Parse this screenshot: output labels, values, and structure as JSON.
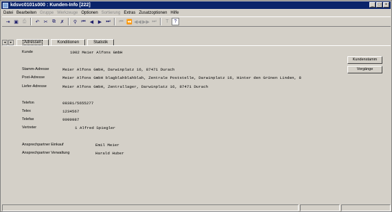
{
  "window": {
    "title": "kdsvc0101s000 : Kunden-Info [222]",
    "controls": [
      "_",
      "□",
      "×"
    ]
  },
  "menu": [
    {
      "label": "Datei",
      "enabled": true
    },
    {
      "label": "Bearbeiten",
      "enabled": true
    },
    {
      "label": "Gruppe",
      "enabled": false
    },
    {
      "label": "Werkzeuge",
      "enabled": false
    },
    {
      "label": "Optionen",
      "enabled": true
    },
    {
      "label": "Sortierung",
      "enabled": false
    },
    {
      "label": "Extras",
      "enabled": true
    },
    {
      "label": "Zusatzoptionen",
      "enabled": true
    },
    {
      "label": "Hilfe",
      "enabled": true
    }
  ],
  "toolbar": {
    "buttons": [
      {
        "name": "exit-icon",
        "glyph": "⇥"
      },
      {
        "name": "save-icon",
        "glyph": "▣"
      },
      {
        "name": "print-icon",
        "glyph": "⎙",
        "disabled": true
      },
      {
        "sep": true
      },
      {
        "name": "undo-icon",
        "glyph": "↶"
      },
      {
        "name": "cut-icon",
        "glyph": "✂"
      },
      {
        "name": "copy-icon",
        "glyph": "⧉"
      },
      {
        "name": "delete-icon",
        "glyph": "✗"
      },
      {
        "sep": true
      },
      {
        "name": "find-icon",
        "glyph": "⚲"
      },
      {
        "name": "first-record-icon",
        "glyph": "⏮"
      },
      {
        "name": "previous-record-icon",
        "glyph": "◀"
      },
      {
        "name": "next-record-icon",
        "glyph": "▶"
      },
      {
        "name": "last-record-icon",
        "glyph": "⏭"
      },
      {
        "sep": true
      },
      {
        "name": "first-group-icon",
        "glyph": "⏮",
        "disabled": true
      },
      {
        "name": "previous-group-icon",
        "glyph": "⏪",
        "disabled": true
      },
      {
        "name": "rewind-icon",
        "glyph": "◀◀",
        "disabled": true
      },
      {
        "name": "forward-icon",
        "glyph": "▶▶",
        "disabled": true
      },
      {
        "name": "last-group-icon",
        "glyph": "⏭",
        "disabled": true
      },
      {
        "sep": true
      },
      {
        "name": "text-icon",
        "glyph": "T",
        "disabled": true
      },
      {
        "name": "context-help-icon",
        "glyph": "?",
        "framed": true
      }
    ]
  },
  "tabs": {
    "scroll_left": "◂",
    "scroll_right": "▸",
    "items": [
      "Adressen",
      "Konditionen",
      "Statistik"
    ],
    "active": 0
  },
  "form": {
    "kunde_label": "Kunde",
    "kunde_value": "1002 Meier Alfons GmbH",
    "stamm_label": "Stamm-Adresse",
    "stamm_value": "Meier Alfons GmbH, Darwinplatz 16, 87471 Durach",
    "post_label": "Post-Adresse",
    "post_value": "Meier Alfons GmbH blagblahblahblah, Zentrale Poststelle, Darwinplatz 16, Hinter den Grünen Linden, 8",
    "liefer_label": "Liefer-Adresse",
    "liefer_value": "Meier Alfons GmbH, Zentrallager, Darwinplatz 16, 87471 Durach",
    "telefon_label": "Telefon",
    "telefon_value": "08381/5655277",
    "telex_label": "Telex",
    "telex_value": "1234567",
    "telefax_label": "Telefax",
    "telefax_value": "9999987",
    "vertreter_label": "Vertreter",
    "vertreter_value": "1 Alfred Spiegler",
    "einkauf_label": "Ansprechpartner Einkauf",
    "einkauf_value": "Emil Meier",
    "verwaltung_label": "Ansprechpartner Verwaltung",
    "verwaltung_value": "Harald Huber"
  },
  "side_buttons": {
    "kundenstamm": "Kundenstamm",
    "vorgaenge": "Vorgänge"
  }
}
